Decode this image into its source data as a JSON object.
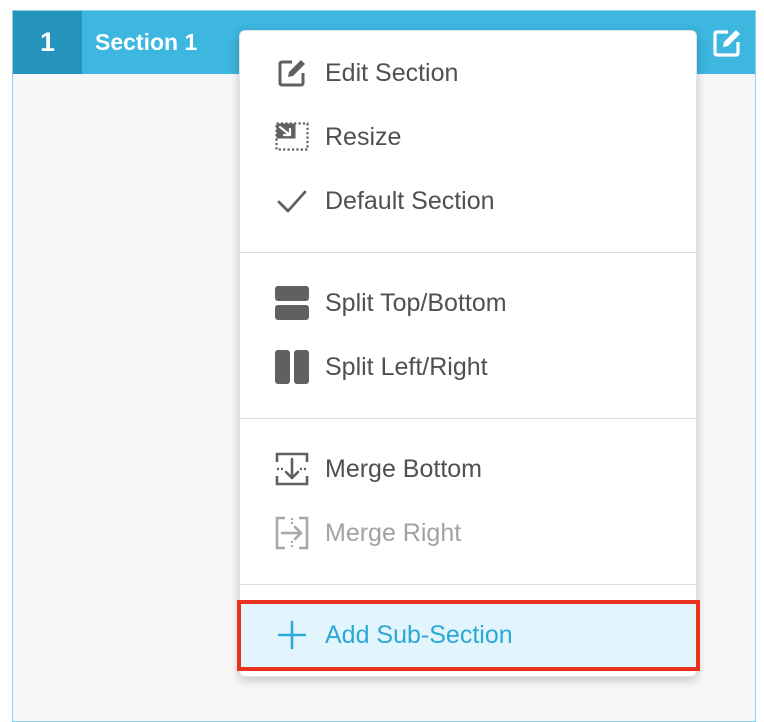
{
  "section": {
    "number": "1",
    "title": "Section 1"
  },
  "menu": {
    "group1": [
      {
        "label": "Edit Section",
        "icon": "edit-icon"
      },
      {
        "label": "Resize",
        "icon": "resize-icon"
      },
      {
        "label": "Default Section",
        "icon": "checkmark-icon"
      }
    ],
    "group2": [
      {
        "label": "Split Top/Bottom",
        "icon": "split-top-bottom-icon"
      },
      {
        "label": "Split Left/Right",
        "icon": "split-left-right-icon"
      }
    ],
    "group3": [
      {
        "label": "Merge Bottom",
        "icon": "merge-bottom-icon"
      },
      {
        "label": "Merge Right",
        "icon": "merge-right-icon",
        "disabled": true
      }
    ],
    "add": {
      "label": "Add Sub-Section",
      "icon": "plus-icon",
      "highlighted": true
    }
  },
  "colors": {
    "header": "#3db6e0",
    "header_number": "#2494bd",
    "accent": "#2aa9d8",
    "highlight_bg": "#e3f5fc",
    "annotation_border": "#e8321e",
    "icon_gray": "#606060"
  }
}
